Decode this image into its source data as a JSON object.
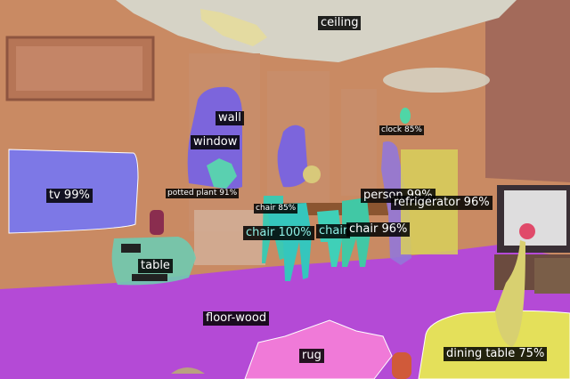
{
  "segments": [
    {
      "id": "ceiling",
      "label": "ceiling",
      "color": "#d9d6c9"
    },
    {
      "id": "wall",
      "label": "wall",
      "color": "#d07a5c"
    },
    {
      "id": "floor-wood",
      "label": "floor-wood",
      "color": "#b44ad6"
    },
    {
      "id": "rug",
      "label": "rug",
      "color": "#f07ad8"
    },
    {
      "id": "tv",
      "label": "tv 99%",
      "color": "#7d78e6"
    },
    {
      "id": "window",
      "label": "window",
      "color": "#6e5ef0"
    },
    {
      "id": "potted-plant",
      "label": "potted plant 91%",
      "color": "#5ad0b0"
    },
    {
      "id": "clock",
      "label": "clock 85%",
      "color": "#4fd6a6"
    },
    {
      "id": "chair-left",
      "label": "chair 85%",
      "color": "#3ec8b0"
    },
    {
      "id": "chair-main",
      "label": "chair 100%",
      "color": "#35c6bd"
    },
    {
      "id": "chair-mid",
      "label": "chair",
      "color": "#3fd0b8"
    },
    {
      "id": "chair-right",
      "label": "chair 96%",
      "color": "#41c8a5"
    },
    {
      "id": "person",
      "label": "person 99%",
      "color": "#9277d8"
    },
    {
      "id": "refrigerator",
      "label": "refrigerator 96%",
      "color": "#d8d05a"
    },
    {
      "id": "table",
      "label": "table",
      "color": "#6fcab0"
    },
    {
      "id": "dining-table",
      "label": "dining table 75%",
      "color": "#e4e05a"
    }
  ]
}
